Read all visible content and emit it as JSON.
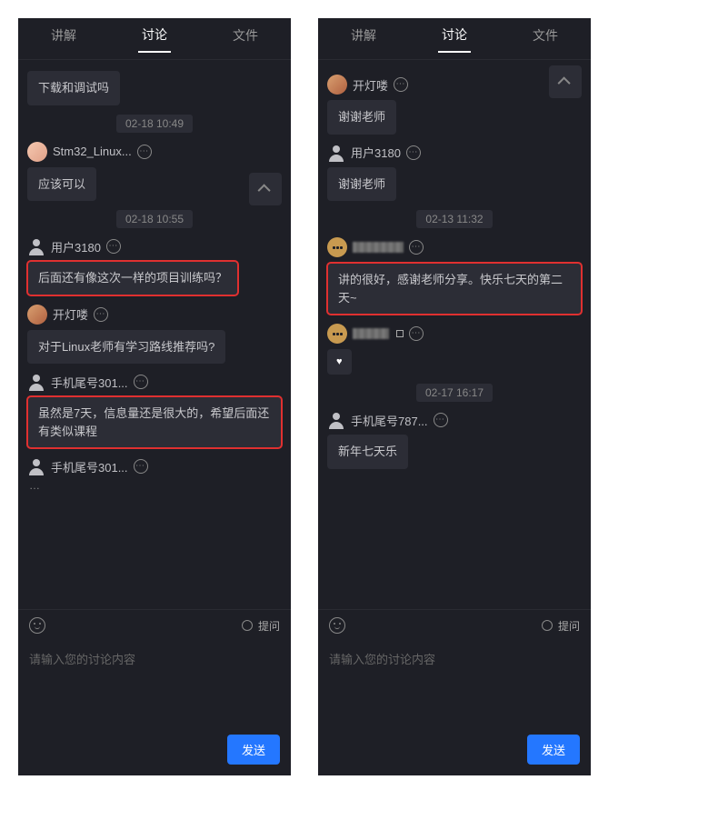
{
  "tabs": {
    "lecture": "讲解",
    "discuss": "讨论",
    "files": "文件"
  },
  "left": {
    "msg_prev": "下载和调试吗",
    "ts1": "02-18 10:49",
    "user1": "Stm32_Linux...",
    "msg1": "应该可以",
    "ts2": "02-18 10:55",
    "user2": "用户3180",
    "msg2": "后面还有像这次一样的项目训练吗？",
    "user3": "开灯喽",
    "msg3": "对于Linux老师有学习路线推荐吗?",
    "user4": "手机尾号301...",
    "msg4": "虽然是7天，信息量还是很大的，希望后面还有类似课程",
    "user5": "手机尾号301..."
  },
  "right": {
    "user1": "开灯喽",
    "msg1": "谢谢老师",
    "user2": "用户3180",
    "msg2": "谢谢老师",
    "ts1": "02-13 11:32",
    "msg3": "讲的很好，感谢老师分享。快乐七天的第二天~",
    "heart": "♥",
    "ts2": "02-17 16:17",
    "user5": "手机尾号787...",
    "msg5": "新年七天乐"
  },
  "footer": {
    "ask": "提问",
    "placeholder": "请输入您的讨论内容",
    "send": "发送"
  }
}
